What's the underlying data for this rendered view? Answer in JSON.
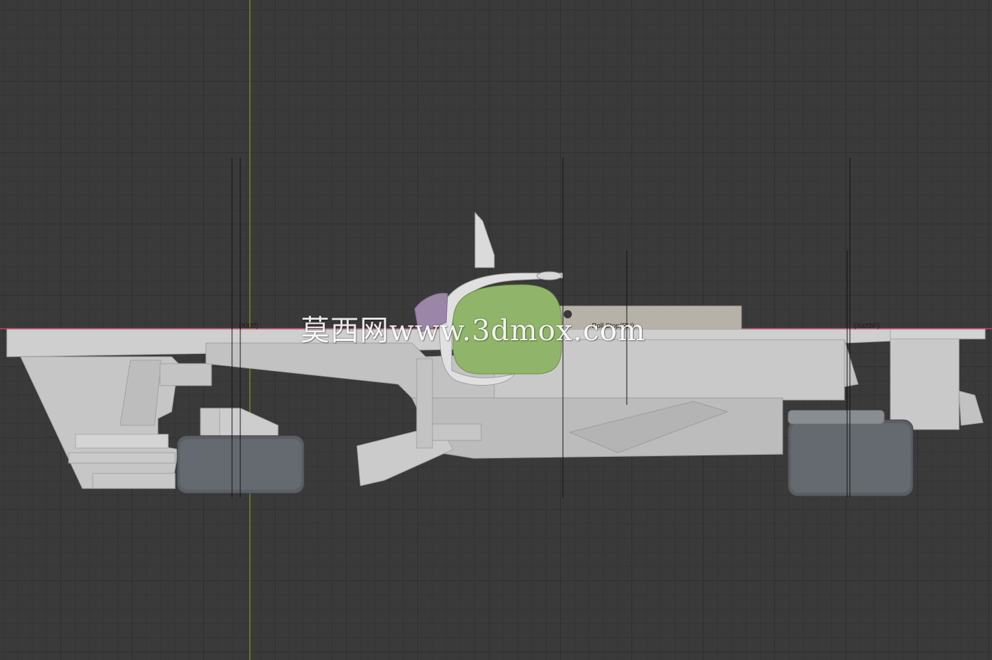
{
  "viewport": {
    "background_color": "#3a3a3a",
    "grid_color": "#2f2f2f",
    "x_axis_color": "#b8475e",
    "y_axis_color": "#6f8a2b"
  },
  "model": {
    "body_color": "#c9c9c9",
    "tire_color": "#5a5f64",
    "seat_color": "#8fb46a",
    "accent_color": "#9c86a8"
  },
  "annotations": {
    "front_axle": "(XaXf)",
    "rear_axle": "(XaXbF)",
    "roll_hoop": "Roll Stop(RH)"
  },
  "watermark": {
    "text": "莫西网www.3dmox.com"
  }
}
